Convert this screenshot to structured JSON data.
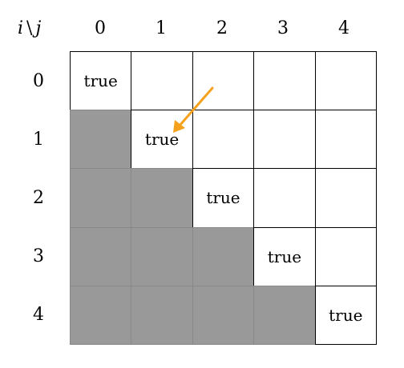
{
  "header": {
    "corner_i": "i",
    "corner_sep": "\\",
    "corner_j": "j"
  },
  "columns": [
    "0",
    "1",
    "2",
    "3",
    "4"
  ],
  "rows": [
    "0",
    "1",
    "2",
    "3",
    "4"
  ],
  "cells": [
    [
      "true",
      "",
      "",
      "",
      ""
    ],
    [
      "",
      "true",
      "",
      "",
      ""
    ],
    [
      "",
      "",
      "true",
      "",
      ""
    ],
    [
      "",
      "",
      "",
      "true",
      ""
    ],
    [
      "",
      "",
      "",
      "",
      "true"
    ]
  ],
  "shaded": [
    [
      false,
      false,
      false,
      false,
      false
    ],
    [
      true,
      false,
      false,
      false,
      false
    ],
    [
      true,
      true,
      false,
      false,
      false
    ],
    [
      true,
      true,
      true,
      false,
      false
    ],
    [
      true,
      true,
      true,
      true,
      false
    ]
  ],
  "colors": {
    "shade": "#999999",
    "arrow": "#f5a11c"
  },
  "arrow": {
    "from_cell": [
      0,
      2
    ],
    "to_cell": [
      1,
      1
    ]
  }
}
